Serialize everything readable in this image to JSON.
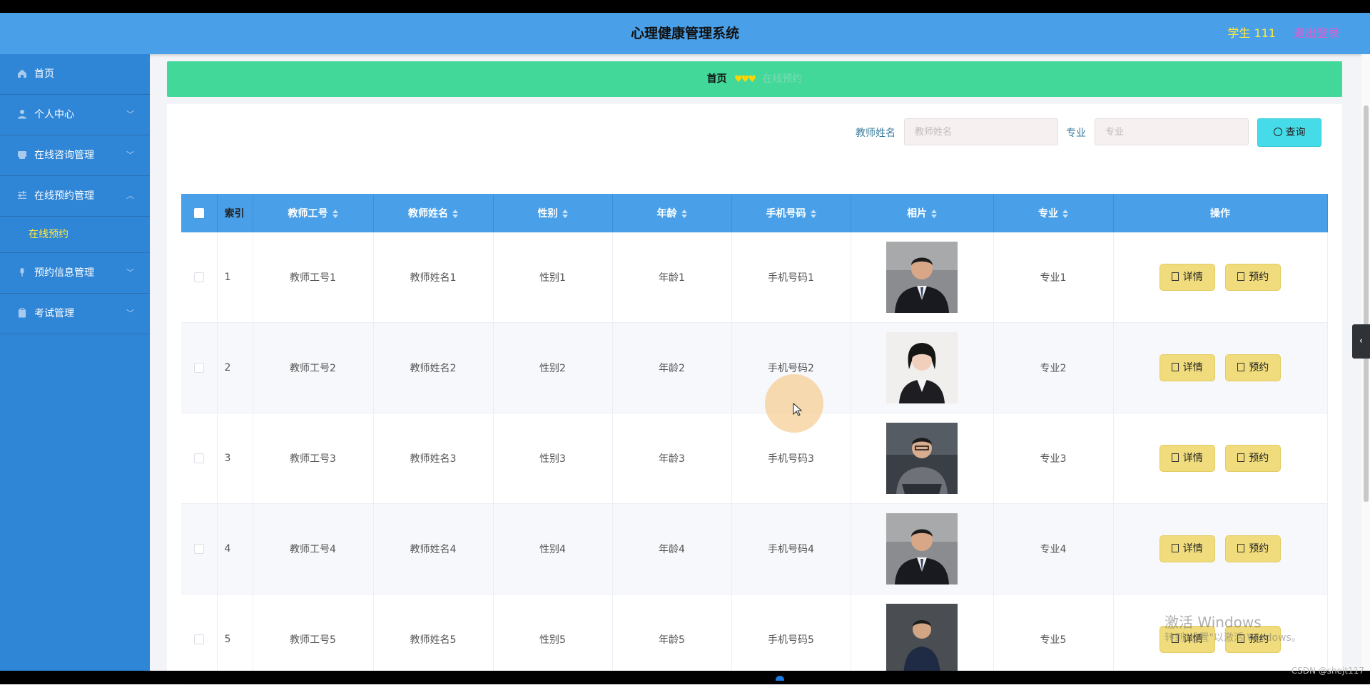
{
  "header": {
    "title": "心理健康管理系统",
    "user": "学生 111",
    "logout": "退出登录"
  },
  "sidebar": {
    "items": [
      {
        "label": "首页",
        "icon": "home-icon"
      },
      {
        "label": "个人中心",
        "icon": "user-icon",
        "chevron": "﹀"
      },
      {
        "label": "在线咨询管理",
        "icon": "chat-icon",
        "chevron": "﹀"
      },
      {
        "label": "在线预约管理",
        "icon": "sliders-icon",
        "chevron": "︿"
      },
      {
        "label": "在线预约",
        "sub": true
      },
      {
        "label": "预约信息管理",
        "icon": "mic-icon",
        "chevron": "﹀"
      },
      {
        "label": "考试管理",
        "icon": "clipboard-icon",
        "chevron": "﹀"
      }
    ]
  },
  "breadcrumb": {
    "home": "首页",
    "separator": "♥♥♥",
    "current": "在线预约"
  },
  "search": {
    "teacher_label": "教师姓名",
    "teacher_placeholder": "教师姓名",
    "major_label": "专业",
    "major_placeholder": "专业",
    "query_label": "查询"
  },
  "table": {
    "headers": [
      "索引",
      "教师工号",
      "教师姓名",
      "性别",
      "年龄",
      "手机号码",
      "相片",
      "专业",
      "操作"
    ],
    "rows": [
      {
        "index": "1",
        "id": "教师工号1",
        "name": "教师姓名1",
        "gender": "性别1",
        "age": "年龄1",
        "phone": "手机号码1",
        "major": "专业1"
      },
      {
        "index": "2",
        "id": "教师工号2",
        "name": "教师姓名2",
        "gender": "性别2",
        "age": "年龄2",
        "phone": "手机号码2",
        "major": "专业2"
      },
      {
        "index": "3",
        "id": "教师工号3",
        "name": "教师姓名3",
        "gender": "性别3",
        "age": "年龄3",
        "phone": "手机号码3",
        "major": "专业3"
      },
      {
        "index": "4",
        "id": "教师工号4",
        "name": "教师姓名4",
        "gender": "性别4",
        "age": "年龄4",
        "phone": "手机号码4",
        "major": "专业4"
      },
      {
        "index": "5",
        "id": "教师工号5",
        "name": "教师姓名5",
        "gender": "性别5",
        "age": "年龄5",
        "phone": "手机号码5",
        "major": "专业5"
      }
    ],
    "detail_label": "详情",
    "reserve_label": "预约"
  },
  "watermark": {
    "line1": "激活 Windows",
    "line2": "转到\"设置\"以激活 Windows。"
  },
  "credit": "CSDN @shejt117",
  "colors": {
    "header": "#4aa0e8",
    "sidebar": "#3086d6",
    "breadcrumb": "#41d89a",
    "active_submenu": "#ffe93b",
    "button": "#f0dc7c",
    "query_button": "#46dbe8",
    "logout": "#e05dd0"
  }
}
